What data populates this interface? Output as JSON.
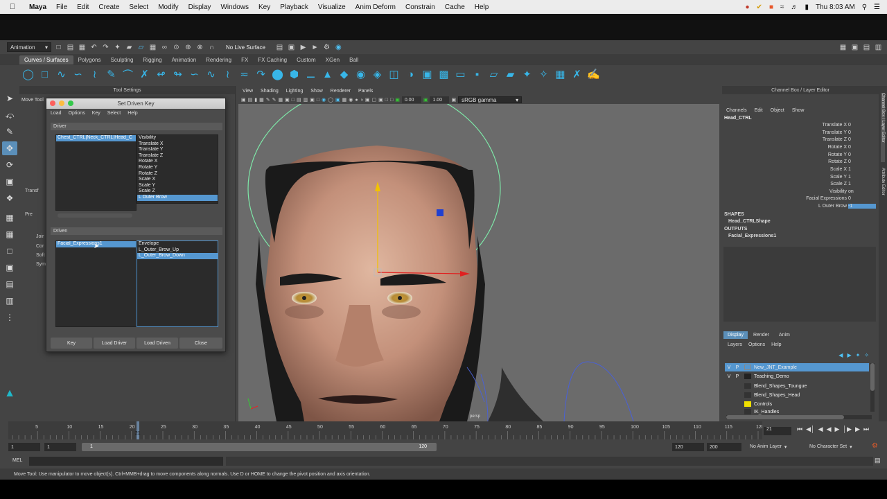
{
  "menubar": {
    "app": "Maya",
    "items": [
      "File",
      "Edit",
      "Create",
      "Select",
      "Modify",
      "Display",
      "Windows",
      "Key",
      "Playback",
      "Visualize",
      "Anim Deform",
      "Constrain",
      "Cache",
      "Help"
    ],
    "clock": "Thu 8:03 AM"
  },
  "status_line": {
    "mode": "Animation",
    "live_surface": "No Live Surface"
  },
  "shelf_tabs": [
    "Curves / Surfaces",
    "Polygons",
    "Sculpting",
    "Rigging",
    "Animation",
    "Rendering",
    "FX",
    "FX Caching",
    "Custom",
    "XGen",
    "Ball"
  ],
  "tool_settings": {
    "title": "Tool Settings",
    "header": "Move Tool",
    "row_labels": [
      "Transf",
      "Pre",
      "Joir",
      "Cor",
      "Soft",
      "Sym"
    ]
  },
  "sdk": {
    "title": "Set Driven Key",
    "menu": [
      "Load",
      "Options",
      "Key",
      "Select",
      "Help"
    ],
    "driver_label": "Driver",
    "driver_object": "Chest_CTRL|Neck_CTRL|Head_C",
    "driver_attrs": [
      "Visibility",
      "Translate X",
      "Translate Y",
      "Translate Z",
      "Rotate X",
      "Rotate Y",
      "Rotate Z",
      "Scale X",
      "Scale Y",
      "Scale Z",
      "L Outer Brow"
    ],
    "driven_label": "Driven",
    "driven_object": "Facial_Expressions1",
    "driven_attrs": [
      "Envelope",
      "L_Outer_Brow_Up",
      "L_Outer_Brow_Down"
    ],
    "buttons": [
      "Key",
      "Load Driver",
      "Load Driven",
      "Close"
    ]
  },
  "viewport": {
    "menu": [
      "View",
      "Shading",
      "Lighting",
      "Show",
      "Renderer",
      "Panels"
    ],
    "field1": "0.00",
    "field2": "1.00",
    "colorspace": "sRGB gamma",
    "camera_label": "persp"
  },
  "channel_box": {
    "title": "Channel Box / Layer Editor",
    "menu": [
      "Channels",
      "Edit",
      "Object",
      "Show"
    ],
    "object": "Head_CTRL",
    "channels": [
      {
        "name": "Translate X",
        "value": "0"
      },
      {
        "name": "Translate Y",
        "value": "0"
      },
      {
        "name": "Translate Z",
        "value": "0"
      },
      {
        "name": "Rotate X",
        "value": "0"
      },
      {
        "name": "Rotate Y",
        "value": "0"
      },
      {
        "name": "Rotate Z",
        "value": "0"
      },
      {
        "name": "Scale X",
        "value": "1"
      },
      {
        "name": "Scale Y",
        "value": "1"
      },
      {
        "name": "Scale Z",
        "value": "1"
      },
      {
        "name": "Visibility",
        "value": "on"
      },
      {
        "name": "Facial Expressions",
        "value": "0"
      },
      {
        "name": "L Outer Brow",
        "value": "-1"
      }
    ],
    "shapes_label": "SHAPES",
    "shape": "Head_CTRLShape",
    "outputs_label": "OUTPUTS",
    "output": "Facial_Expressions1",
    "side_tabs": [
      "Channel Box / Layer Editor",
      "Attribute Editor"
    ]
  },
  "layer_editor": {
    "tabs": [
      "Display",
      "Render",
      "Anim"
    ],
    "menu": [
      "Layers",
      "Options",
      "Help"
    ],
    "layers": [
      {
        "v": "V",
        "p": "P",
        "name": "New_JNT_Example"
      },
      {
        "v": "V",
        "p": "P",
        "name": "Teaching_Demo"
      },
      {
        "v": "",
        "p": "",
        "name": "Blend_Shapes_Toungue"
      },
      {
        "v": "",
        "p": "",
        "name": "Blend_Shapes_Head"
      },
      {
        "v": "",
        "p": "",
        "name": "Controls"
      },
      {
        "v": "",
        "p": "",
        "name": "IK_Handles"
      }
    ]
  },
  "timeline": {
    "ticks": [
      "5",
      "10",
      "15",
      "20",
      "25",
      "30",
      "35",
      "40",
      "45",
      "50",
      "55",
      "60",
      "65",
      "70",
      "75",
      "80",
      "85",
      "90",
      "95",
      "100",
      "105",
      "110",
      "115",
      "120"
    ],
    "current_frame": "21",
    "current_display": "21"
  },
  "range": {
    "start": "1",
    "start2": "1",
    "slider_start": "1",
    "slider_end": "120",
    "end": "120",
    "end2": "200",
    "anim_layer": "No Anim Layer",
    "char_set": "No Character Set"
  },
  "mel": {
    "label": "MEL"
  },
  "help_line": "Move Tool: Use manipulator to move object(s). Ctrl+MMB+drag to move components along normals. Use D or HOME to change the pivot position and axis orientation.",
  "colors": {
    "selection": "#5597d0",
    "shelf_icon": "#38b6e8",
    "manip_y": "#f2c200",
    "manip_x": "#e02020",
    "manip_z": "#2040d0",
    "ctrl_curve": "#7ee8a8"
  }
}
